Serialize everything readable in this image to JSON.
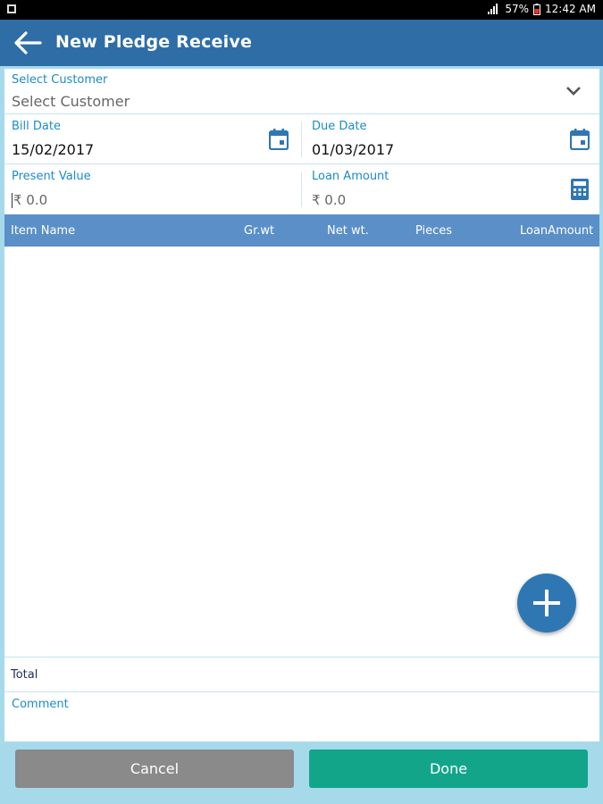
{
  "status": {
    "battery": "57%",
    "time": "12:42 AM"
  },
  "app_bar": {
    "title": "New Pledge Receive"
  },
  "customer": {
    "label": "Select Customer",
    "value": "Select Customer"
  },
  "bill_date": {
    "label": "Bill Date",
    "value": "15/02/2017"
  },
  "due_date": {
    "label": "Due Date",
    "value": "01/03/2017"
  },
  "present_value": {
    "label": "Present Value",
    "value": "₹ 0.0"
  },
  "loan_amount": {
    "label": "Loan Amount",
    "value": "₹ 0.0"
  },
  "table": {
    "columns": [
      "Item Name",
      "Gr.wt",
      "Net wt.",
      "Pieces",
      "LoanAmount"
    ]
  },
  "total": {
    "label": "Total"
  },
  "comment": {
    "label": "Comment"
  },
  "buttons": {
    "cancel": "Cancel",
    "done": "Done"
  },
  "colors": {
    "app_bar": "#2f6da7",
    "table_head": "#5b8fc7",
    "done": "#12a58a",
    "cancel": "#8a8a8a",
    "label": "#1b8bc7"
  },
  "icons": [
    "back-arrow-icon",
    "chevron-down-icon",
    "calendar-icon",
    "calculator-icon",
    "plus-icon"
  ]
}
